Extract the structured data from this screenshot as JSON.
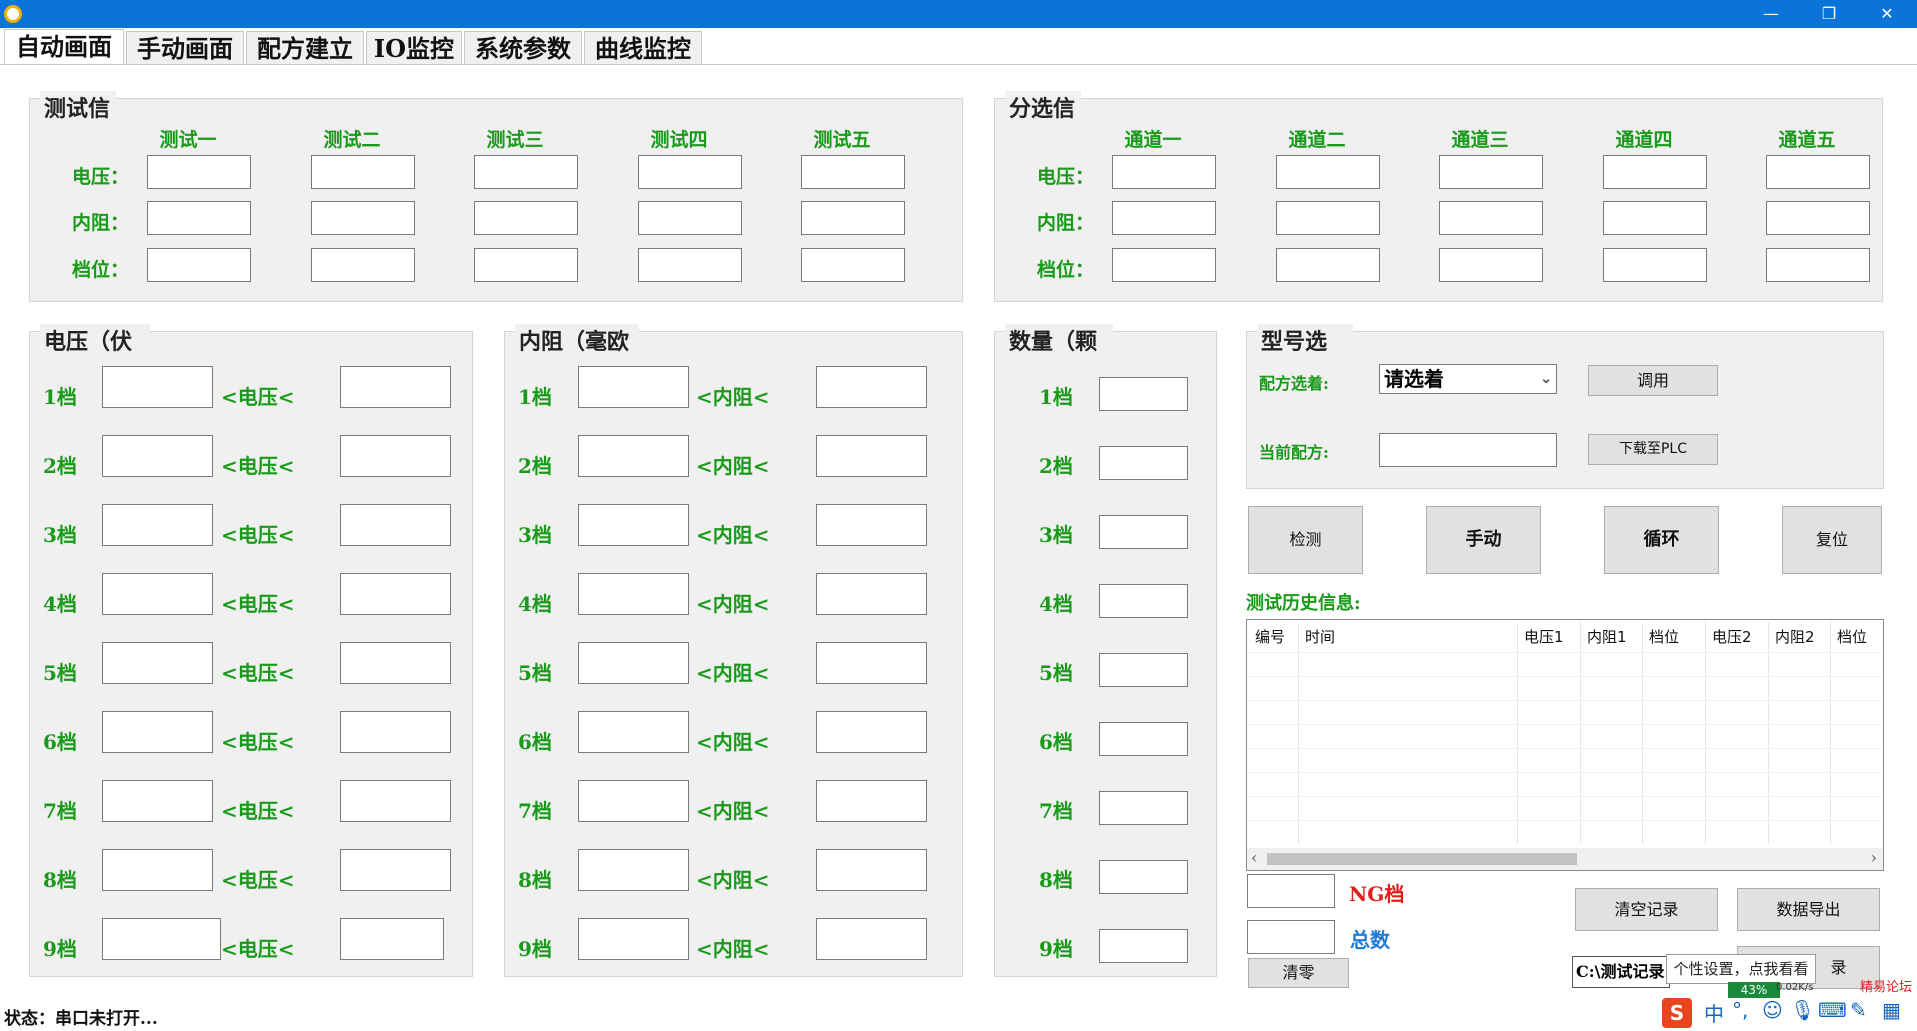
{
  "window": {
    "minimize": "—",
    "restore": "❐",
    "close": "✕"
  },
  "tabs": [
    "自动画面",
    "手动画面",
    "配方建立",
    "IO监控",
    "系统参数",
    "曲线监控"
  ],
  "test_group": {
    "title": "测试信",
    "columns": [
      "测试一",
      "测试二",
      "测试三",
      "测试四",
      "测试五"
    ],
    "rows": [
      "电压：",
      "内阻：",
      "档位："
    ]
  },
  "sort_group": {
    "title": "分选信",
    "columns": [
      "通道一",
      "通道二",
      "通道三",
      "通道四",
      "通道五"
    ],
    "rows": [
      "电压：",
      "内阻：",
      "档位："
    ]
  },
  "voltage_group": {
    "title": "电压（伏",
    "levels": [
      "1档",
      "2档",
      "3档",
      "4档",
      "5档",
      "6档",
      "7档",
      "8档",
      "9档"
    ],
    "compare": "<电压<"
  },
  "resistance_group": {
    "title": "内阻（毫欧",
    "levels": [
      "1档",
      "2档",
      "3档",
      "4档",
      "5档",
      "6档",
      "7档",
      "8档",
      "9档"
    ],
    "compare": "<内阻<"
  },
  "count_group": {
    "title": "数量（颗",
    "levels": [
      "1档",
      "2档",
      "3档",
      "4档",
      "5档",
      "6档",
      "7档",
      "8档",
      "9档"
    ]
  },
  "model_group": {
    "title": "型号选",
    "recipe_select_label": "配方选着:",
    "recipe_select_value": "请选着",
    "call_button": "调用",
    "current_recipe_label": "当前配方:",
    "download_button": "下载至PLC"
  },
  "mode_buttons": {
    "detect": "检测",
    "manual": "手动",
    "cycle": "循环",
    "reset": "复位"
  },
  "history": {
    "title": "测试历史信息:",
    "columns": [
      "编号",
      "时间",
      "电压1",
      "内阻1",
      "档位",
      "电压2",
      "内阻2",
      "档位"
    ],
    "scroll_left": "‹",
    "scroll_right": "›"
  },
  "ng_label": "NG档",
  "total_label": "总数",
  "clear_zero_button": "清零",
  "clear_records_button": "清空记录",
  "export_button": "数据导出",
  "path_value": "C:\\测试记录",
  "record_button_partial": "录",
  "tooltip": "个性设置，点我看看",
  "tray": {
    "ime": "中",
    "punct": "°,",
    "percent": "43%",
    "speed": "0.02K/s",
    "watermark": "精易论坛"
  },
  "status": "状态：串口未打开..."
}
